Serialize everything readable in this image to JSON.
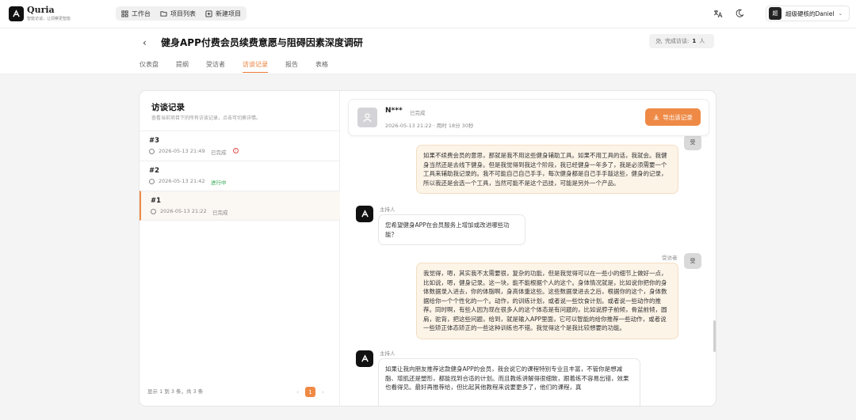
{
  "app": {
    "name": "Quria",
    "slogan": "智能访谈，让洞察更智能"
  },
  "nav": [
    {
      "label": "工作台",
      "icon": "grid-icon"
    },
    {
      "label": "项目列表",
      "icon": "folder-icon"
    },
    {
      "label": "新建项目",
      "icon": "plus-square-icon"
    }
  ],
  "user": {
    "avatar": "超",
    "name": "超级硬核的Daniel"
  },
  "project": {
    "title": "健身APP付费会员续费意愿与阻碍因素深度调研",
    "completed_label": "完成访谈:",
    "completed_count": "1",
    "completed_unit": "人"
  },
  "tabs": [
    "仪表盘",
    "提纲",
    "受访者",
    "访谈记录",
    "报告",
    "表格"
  ],
  "active_tab": "访谈记录",
  "records_panel": {
    "title": "访谈记录",
    "subtitle": "查看当前项目下的所有访谈记录，点击可切换详情。",
    "records": [
      {
        "id": "#3",
        "time": "2026-05-13 21:49",
        "status": "已完成"
      },
      {
        "id": "#2",
        "time": "2026-05-13 21:42",
        "status": "进行中"
      },
      {
        "id": "#1",
        "time": "2026-05-13 21:22",
        "status": "已完成"
      }
    ],
    "footer": "显示 1 到 3 条，共 3 条",
    "page_prev": "‹",
    "page_current": "1",
    "page_next": "›"
  },
  "interview": {
    "name": "N***",
    "status": "已完成",
    "time": "2026-05-13 21:22",
    "duration": "用时 18分 30秒",
    "export_label": "导出该记录"
  },
  "messages": {
    "respondent_label": "受访者",
    "host_label": "主持人",
    "respondent_avatar": "受",
    "m1": "如果不续费会员的意思，那就是我不用这些健身辅助工具。如果不用工具的话，我就会。我健身当然还是去线下健身。但是我觉得到我这个阶段，我已经健身一年多了，我是必须需要一个工具来辅助我记录的。我不可能自己自己手手，每次健身都是自己手手敲这些，健身的记录，所以我还是会选一个工具，当然可能不是这个迅技，可能是另外一个产品。",
    "m2": "您希望健身APP在会员服务上增加或改进哪些功能？",
    "m3": "我觉得，嗯，其实我不太需要很，复杂的功能，但是我觉得可以在一些小的细节上做好一点，比如说，嗯，健身记录。这一块，能不能根据个人的这个。身体情况就是，比如说你把你的身体数据录入进去，你的体脂啊，身高体重这些。这些数据录进去之后，根据你的这个，身体数据给你一个个性化的一个。动作，的训练计划，或者说一些饮食计划。或者说一些动作的推荐。同时啊，有些人因为现在很多人的这个体态是有问题的，比如说脖子前倾，骨盆前倾，圆肩，驼背，把这些问题，给到，就是输入APP里面，它可以智能的给你推荐一些动作，或者说一些矫正体态矫正的一些这种训练也不错。我觉得这个是我比较想要的功能。",
    "m4": "如果让我向朋友推荐这款健身APP的会员，我会说它的课程特别专业且丰富，不管你是想减脂、增肌还是塑形，都能找到合适的计划。而且教练讲解得很细致，跟着练不容易出错，效果也看得见。最好再推荐给，但比起其他教程来说要更多了，他们的课程，真"
  }
}
